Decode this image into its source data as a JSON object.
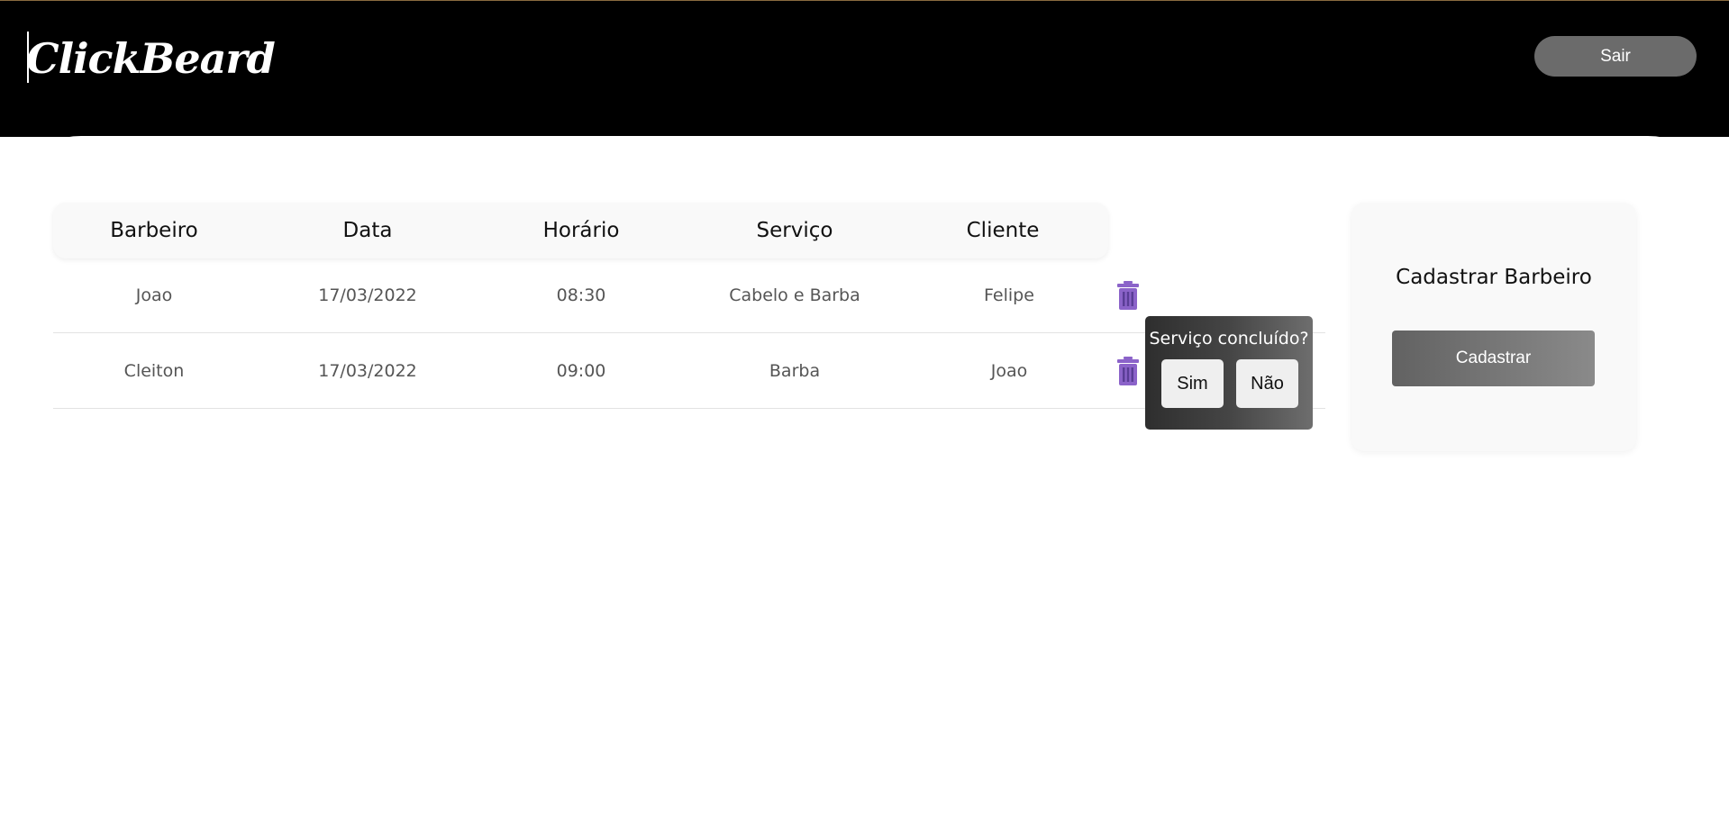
{
  "header": {
    "logo": "ClickBeard",
    "logout_label": "Sair"
  },
  "table": {
    "columns": [
      "Barbeiro",
      "Data",
      "Horário",
      "Serviço",
      "Cliente"
    ],
    "rows": [
      {
        "barbeiro": "Joao",
        "data": "17/03/2022",
        "horario": "08:30",
        "servico": "Cabelo e Barba",
        "cliente": "Felipe"
      },
      {
        "barbeiro": "Cleiton",
        "data": "17/03/2022",
        "horario": "09:00",
        "servico": "Barba",
        "cliente": "Joao"
      }
    ],
    "delete_icon": "trash-icon"
  },
  "confirm_popup": {
    "question": "Serviço concluído?",
    "yes_label": "Sim",
    "no_label": "Não"
  },
  "register_card": {
    "title": "Cadastrar Barbeiro",
    "button_label": "Cadastrar"
  },
  "colors": {
    "topbar": "#000000",
    "trash_icon": "#8b63c9",
    "logout_button": "#6b6b6b"
  }
}
